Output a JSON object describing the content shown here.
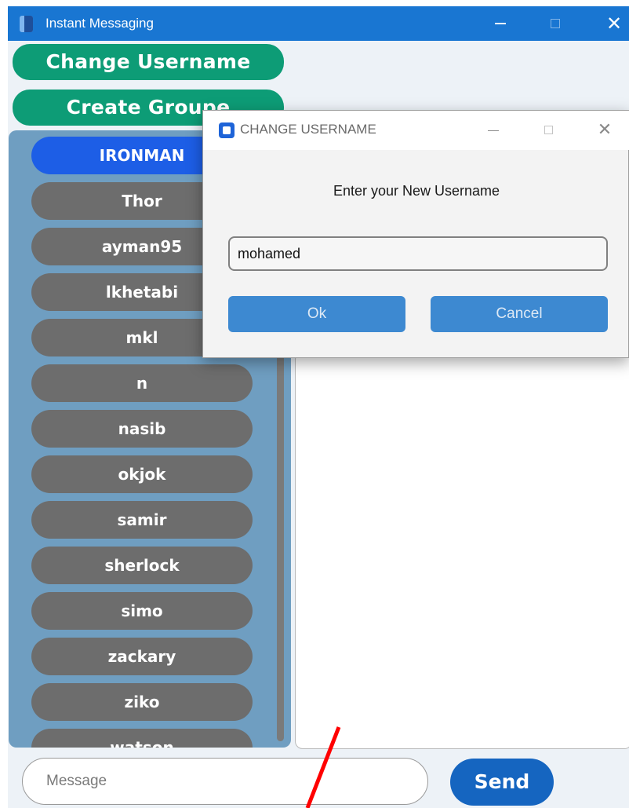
{
  "window": {
    "title": "Instant Messaging",
    "icon": "app-icon",
    "controls": [
      "minimize-icon",
      "maximize-icon",
      "close-icon"
    ],
    "close_glyph": "✕"
  },
  "actions": {
    "change_username_label": "Change Username",
    "create_group_label": "Create Groupe"
  },
  "users": {
    "items": [
      {
        "label": "IRONMAN",
        "active": true
      },
      {
        "label": "Thor"
      },
      {
        "label": "ayman95"
      },
      {
        "label": "lkhetabi"
      },
      {
        "label": "mkl"
      },
      {
        "label": "n"
      },
      {
        "label": "nasib"
      },
      {
        "label": "okjok"
      },
      {
        "label": "samir"
      },
      {
        "label": "sherlock"
      },
      {
        "label": "simo"
      },
      {
        "label": "zackary"
      },
      {
        "label": "ziko"
      },
      {
        "label": "watson"
      }
    ]
  },
  "composer": {
    "placeholder": "Message",
    "send_label": "Send"
  },
  "dialog": {
    "title": "CHANGE USERNAME",
    "prompt": "Enter your New Username",
    "input_value": "mohamed",
    "ok_label": "Ok",
    "cancel_label": "Cancel",
    "close_glyph": "✕"
  },
  "colors": {
    "titlebar": "#1976d2",
    "action_button": "#0d9c76",
    "user_panel": "#6f9ec1",
    "user_item": "#6d6d6d",
    "user_item_active": "#1d5ee6",
    "send_button": "#1565c0",
    "dialog_button": "#3d89d1",
    "annotation": "#ff0000"
  }
}
